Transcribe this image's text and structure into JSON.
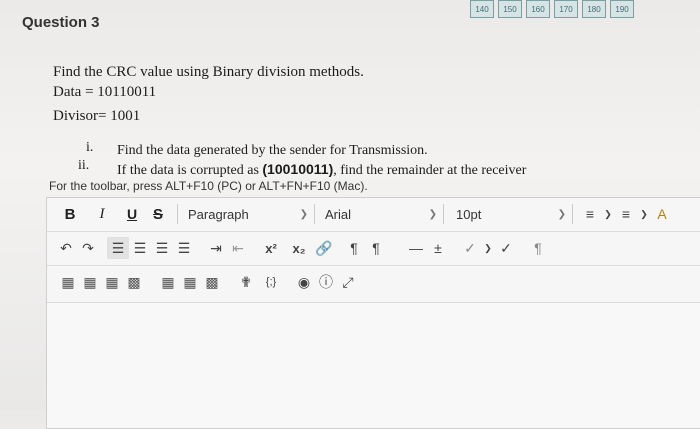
{
  "page_tabs": [
    "140",
    "150",
    "160",
    "170",
    "180",
    "190"
  ],
  "question": {
    "title": "Question 3",
    "prompt": "Find the CRC value using Binary division methods.",
    "data_line": "Data = 10110011",
    "divisor_line": "Divisor= 1001",
    "items": [
      {
        "num": "i.",
        "text": "Find the data generated by the sender for Transmission."
      },
      {
        "num": "ii.",
        "text_before": "If the data is corrupted as ",
        "bold": "(10010011)",
        "text_after": ", find the remainder at the receiver"
      }
    ]
  },
  "editor": {
    "hint": "For the toolbar, press ALT+F10 (PC) or ALT+FN+F10 (Mac).",
    "bold": "B",
    "italic": "I",
    "underline": "U",
    "strike": "S",
    "paragraph": "Paragraph",
    "font": "Arial",
    "size": "10pt",
    "superscript": "x²",
    "subscript": "x₂",
    "embed": "{;}"
  }
}
